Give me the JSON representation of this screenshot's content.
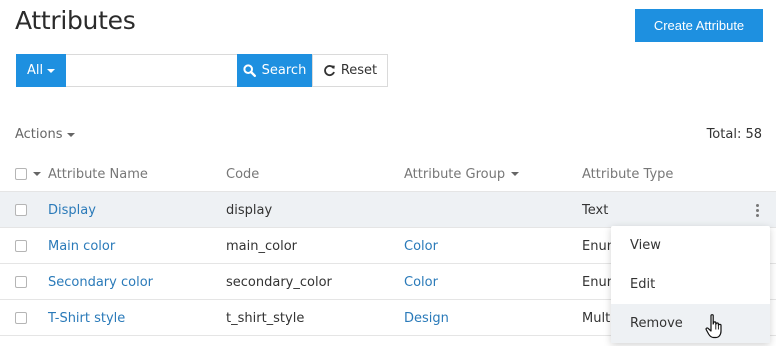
{
  "page": {
    "title": "Attributes"
  },
  "toolbar": {
    "create_label": "Create Attribute"
  },
  "search": {
    "filter_label": "All",
    "value": "",
    "placeholder": "",
    "search_label": "Search",
    "reset_label": "Reset"
  },
  "list": {
    "actions_label": "Actions",
    "total_label": "Total: 58"
  },
  "table": {
    "columns": [
      "Attribute Name",
      "Code",
      "Attribute Group",
      "Attribute Type"
    ],
    "rows": [
      {
        "name": "Display",
        "code": "display",
        "group": "",
        "type": "Text"
      },
      {
        "name": "Main color",
        "code": "main_color",
        "group": "Color",
        "type": "Enum"
      },
      {
        "name": "Secondary color",
        "code": "secondary_color",
        "group": "Color",
        "type": "Enum"
      },
      {
        "name": "T-Shirt style",
        "code": "t_shirt_style",
        "group": "Design",
        "type": "Multi"
      }
    ]
  },
  "row_menu": {
    "items": [
      "View",
      "Edit",
      "Remove"
    ]
  },
  "colors": {
    "accent": "#1e90e0",
    "link": "#2a7ab9",
    "highlight_row": "#eef1f4"
  },
  "icons": {
    "search": "magnifier-icon",
    "reset": "refresh-icon",
    "menu": "kebab-icon",
    "cursor": "hand-pointer-icon"
  }
}
